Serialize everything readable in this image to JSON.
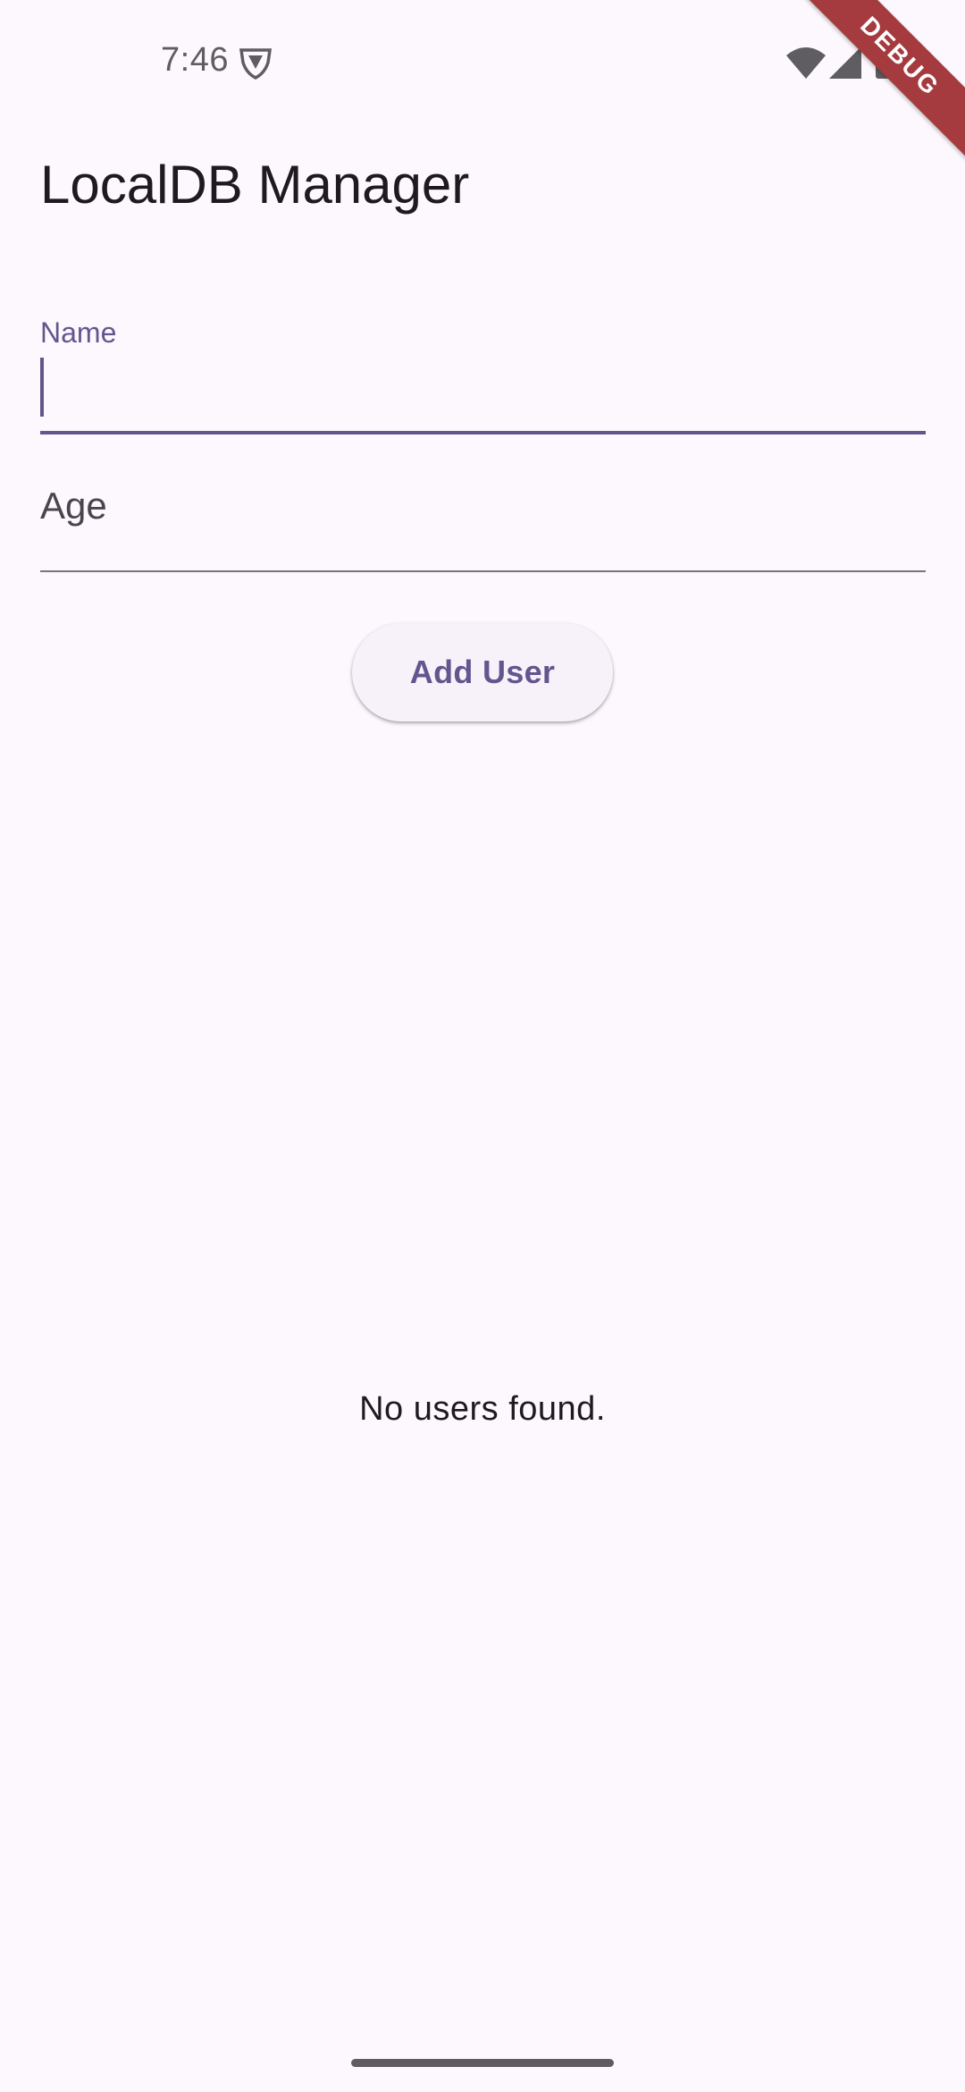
{
  "status_bar": {
    "time": "7:46",
    "icons": [
      "shield-icon",
      "wifi-icon",
      "signal-icon",
      "battery-icon"
    ],
    "icon_color": "#5f5c62"
  },
  "debug_banner": {
    "label": "DEBUG",
    "color": "#a53b3f"
  },
  "app_bar": {
    "title": "LocalDB Manager"
  },
  "form": {
    "name_field": {
      "label": "Name",
      "value": "",
      "focused": true
    },
    "age_field": {
      "label": "Age",
      "value": "",
      "focused": false
    },
    "add_button_label": "Add User"
  },
  "user_list": {
    "empty_message": "No users found."
  },
  "colors": {
    "background": "#fdf7fe",
    "primary": "#65558f",
    "on_surface": "#1d1b20",
    "outline": "#79747e"
  }
}
